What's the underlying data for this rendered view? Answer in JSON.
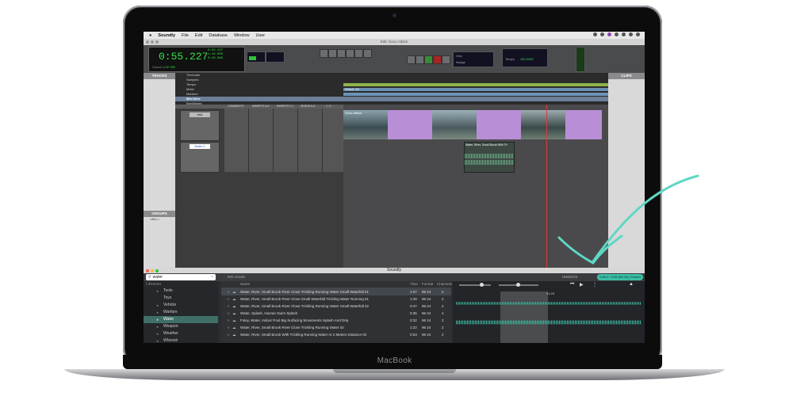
{
  "device": {
    "brand_label": "MacBook"
  },
  "menubar": {
    "app": "Soundly",
    "items": [
      "File",
      "Edit",
      "Database",
      "Window",
      "User"
    ]
  },
  "protools": {
    "window_title": "Edit: Sooo Attack",
    "counter_main": "0:55.227",
    "counter_start": "0:55.227",
    "counter_end": "1:16.006",
    "counter_length": "0:20.869",
    "counter_labels": [
      "Start",
      "End",
      "Length"
    ],
    "cursor_label": "Cursor",
    "cursor_value": "1:02.785",
    "grid_label": "Grid",
    "nudge_label": "Nudge",
    "tempo_label": "Tempo",
    "tempo_value": "120.0000",
    "tracks_header": "TRACKS",
    "groups_header": "GROUPS",
    "groups_all": "<ALL>",
    "clips_header": "CLIPS",
    "rulers": [
      "Timecode",
      "Samples",
      "Tempo",
      "Meter",
      "Markers",
      "Min:Secs",
      "Bars|Beats"
    ],
    "meter_value": "Default: 4/4",
    "io_columns": [
      "COMMENTS",
      "INSERTS A-E",
      "INSERTS F-J",
      "SENDS A-E",
      "I / O"
    ],
    "track_video": "bria",
    "track_audio": "Audio 1",
    "clip_video": "Sooo Attack",
    "clip_audio": "Water, River, Small Brook With Tri"
  },
  "soundly": {
    "window_title": "Soundly",
    "search_value": "water",
    "results_count": "500 results",
    "undock_label": "UNDOCK",
    "play_status": "0:05.2 / 0:28 (00:44) | Pocket",
    "libraries_label": "Libraries",
    "playhead_time": "01:29",
    "sidebar_items": [
      {
        "label": "Tools",
        "arrow": "►"
      },
      {
        "label": "Toys",
        "arrow": ""
      },
      {
        "label": "Vehicle",
        "arrow": "►"
      },
      {
        "label": "Warfare",
        "arrow": "►"
      },
      {
        "label": "Water",
        "arrow": "►",
        "selected": true
      },
      {
        "label": "Weapon",
        "arrow": "►"
      },
      {
        "label": "Weather",
        "arrow": "►"
      },
      {
        "label": "Whoosh",
        "arrow": "►"
      }
    ],
    "columns": {
      "name": "Name",
      "time": "Time",
      "format": "Format",
      "channels": "Channels"
    },
    "rows": [
      {
        "name": "Water, River, Small Brook River Close Trickling Running Water Small Waterfall 01",
        "time": "1:07",
        "format": "96 24",
        "channels": "2",
        "selected": true
      },
      {
        "name": "Water, River, Small Brook River Close Small Waterfall Trickling Water Running 01",
        "time": "1:29",
        "format": "96 24",
        "channels": "2"
      },
      {
        "name": "Water, River, Small Brook River Close Trickling Running Water Small Waterfall 02",
        "time": "0:47",
        "format": "96 24",
        "channels": "2"
      },
      {
        "name": "Water, Splash, Human Swim Splash",
        "time": "0:35",
        "format": "96 24",
        "channels": "2"
      },
      {
        "name": "Foley, Water, Indoor Pool Big Surfacing Movements Splash And Drip",
        "time": "0:32",
        "format": "96 24",
        "channels": "2"
      },
      {
        "name": "Water, River, Small Brook River Close Trickling Running Water 02",
        "time": "1:22",
        "format": "96 24",
        "channels": "2"
      },
      {
        "name": "Water, River, Small Brook With Trickling Running Water At 2 Meters Distance 02",
        "time": "0:53",
        "format": "96 24",
        "channels": "2"
      }
    ]
  },
  "colors": {
    "accent": "#3bbfa5",
    "counter_green": "#36e04a",
    "annotation": "#5fd7c4"
  }
}
